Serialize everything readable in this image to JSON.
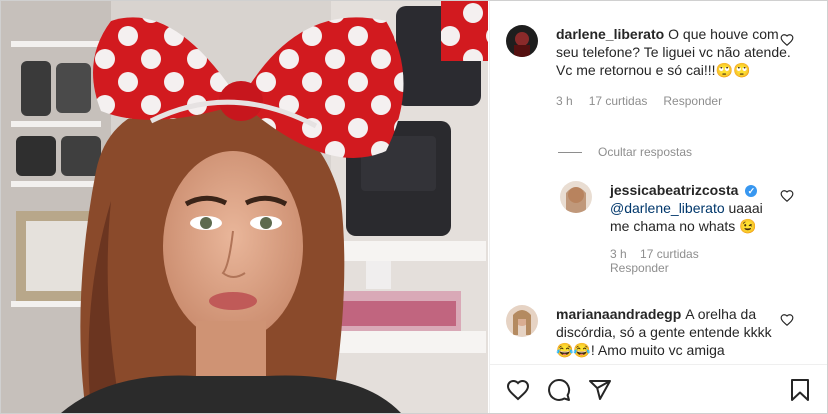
{
  "comments": [
    {
      "username": "darlene_liberato",
      "text": "O que houve com seu telefone? Te liguei vc não atende. Vc me retornou e só cai!!!🙄🙄",
      "time": "3 h",
      "likes": "17 curtidas",
      "reply": "Responder"
    },
    {
      "username": "jessicabeatrizcosta",
      "mention": "@darlene_liberato",
      "text": " uaaai me chama no whats 😉",
      "time": "3 h",
      "likes": "17 curtidas",
      "reply": "Responder",
      "verified": "✓"
    },
    {
      "username": "marianaandradegp",
      "text": "A orelha da discórdia, só a gente entende kkkk 😂😂! Amo muito vc amiga"
    }
  ],
  "hide_replies": "Ocultar respostas",
  "colors": {
    "accent": "#3897f0",
    "muted": "#8e8e8e",
    "text": "#262626"
  },
  "icons": [
    "heart-icon",
    "comment-icon",
    "share-icon",
    "bookmark-icon"
  ]
}
